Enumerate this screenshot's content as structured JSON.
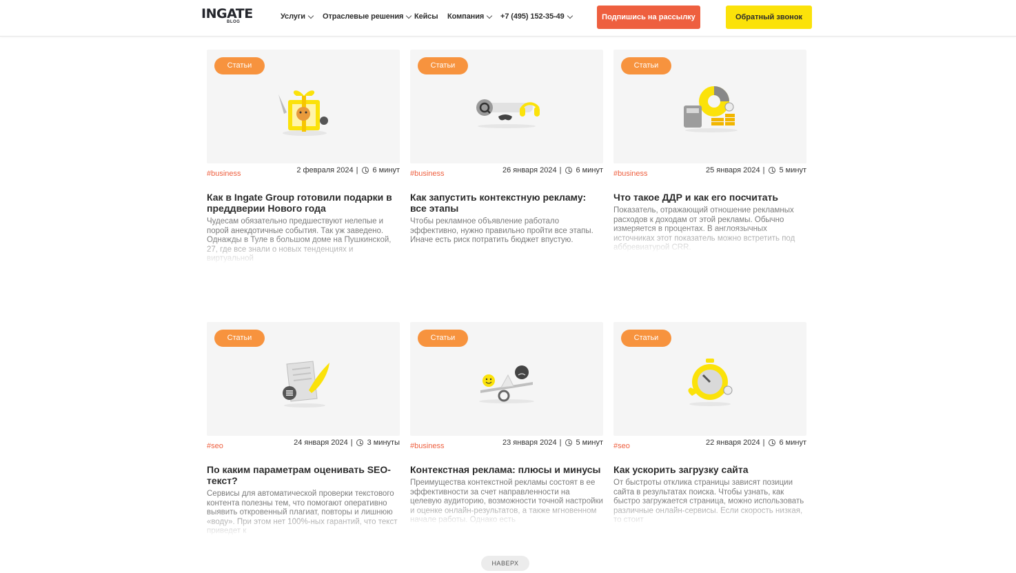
{
  "header": {
    "logo": "INGATE",
    "logo_sub": "BLOG",
    "nav": {
      "services": "Услуги",
      "industry": "Отраслевые решения",
      "cases": "Кейсы",
      "company": "Компания",
      "phone": "+7 (495) 152-35-49"
    },
    "subscribe_label": "Подпишись на рассылку",
    "callback_label": "Обратный звонок"
  },
  "articles": [
    {
      "badge": "Статьи",
      "tag": "#business",
      "date": "2 февраля 2024",
      "read_time": "6 минут",
      "title": "Как в Ingate Group готовили подарки в преддверии Нового года",
      "desc": "Чудесам обязательно предшествуют нелепые и порой анекдотичные события. Так уж заведено. Однажды в Туле в большом доме на Пушкинской, 27, где все знали о новых тенденциях и виртуальной",
      "icon": "gift-box-icon"
    },
    {
      "badge": "Статьи",
      "tag": "#business",
      "date": "26 января 2024",
      "read_time": "6 минут",
      "title": "Как запустить контекстную рекламу: все этапы",
      "desc": "Чтобы рекламное объявление работало эффективно, нужно правильно пройти все этапы. Иначе есть риск потратить бюджет впустую.",
      "icon": "search-gamepad-headphones-icon"
    },
    {
      "badge": "Статьи",
      "tag": "#business",
      "date": "25 января 2024",
      "read_time": "5 минут",
      "title": "Что такое ДДР и как его посчитать",
      "desc": "Показатель, отражающий отношение рекламных расходов к доходам от этой рекламы. Обычно измеряется в процентах. В англоязычных источниках этот показатель можно встретить под аббревиатурой CRR.",
      "icon": "calculator-coins-icon"
    },
    {
      "badge": "Статьи",
      "tag": "#seo",
      "date": "24 января 2024",
      "read_time": "3 минуты",
      "title": "По каким параметрам оценивать SEO-текст?",
      "desc": "Сервисы для автоматической проверки текстового контента полезны тем, что помогают оперативно выявить откровенный плагиат, повторы и лишнюю «воду». При этом нет 100%-ных гарантий, что текст приведет к",
      "icon": "scroll-feather-icon"
    },
    {
      "badge": "Статьи",
      "tag": "#business",
      "date": "23 января 2024",
      "read_time": "5 минут",
      "title": "Контекстная реклама: плюсы и минусы",
      "desc": "Преимущества контекстной рекламы состоят в ее эффективности за счет направленности на целевую аудиторию, возможности точной настройки и оценке онлайн-результатов, а также мгновенном начале работы. Однако есть",
      "icon": "scales-smiley-icon"
    },
    {
      "badge": "Статьи",
      "tag": "#seo",
      "date": "22 января 2024",
      "read_time": "6 минут",
      "title": "Как ускорить загрузку сайта",
      "desc": "От быстроты отклика страницы зависят позиции сайта в результатах поиска. Чтобы узнать, как быстро загружается страница, можно использовать различные онлайн-сервисы. Если скорость низкая, то стоит",
      "icon": "stopwatch-icon"
    }
  ],
  "to_top_label": "НАВЕРХ"
}
